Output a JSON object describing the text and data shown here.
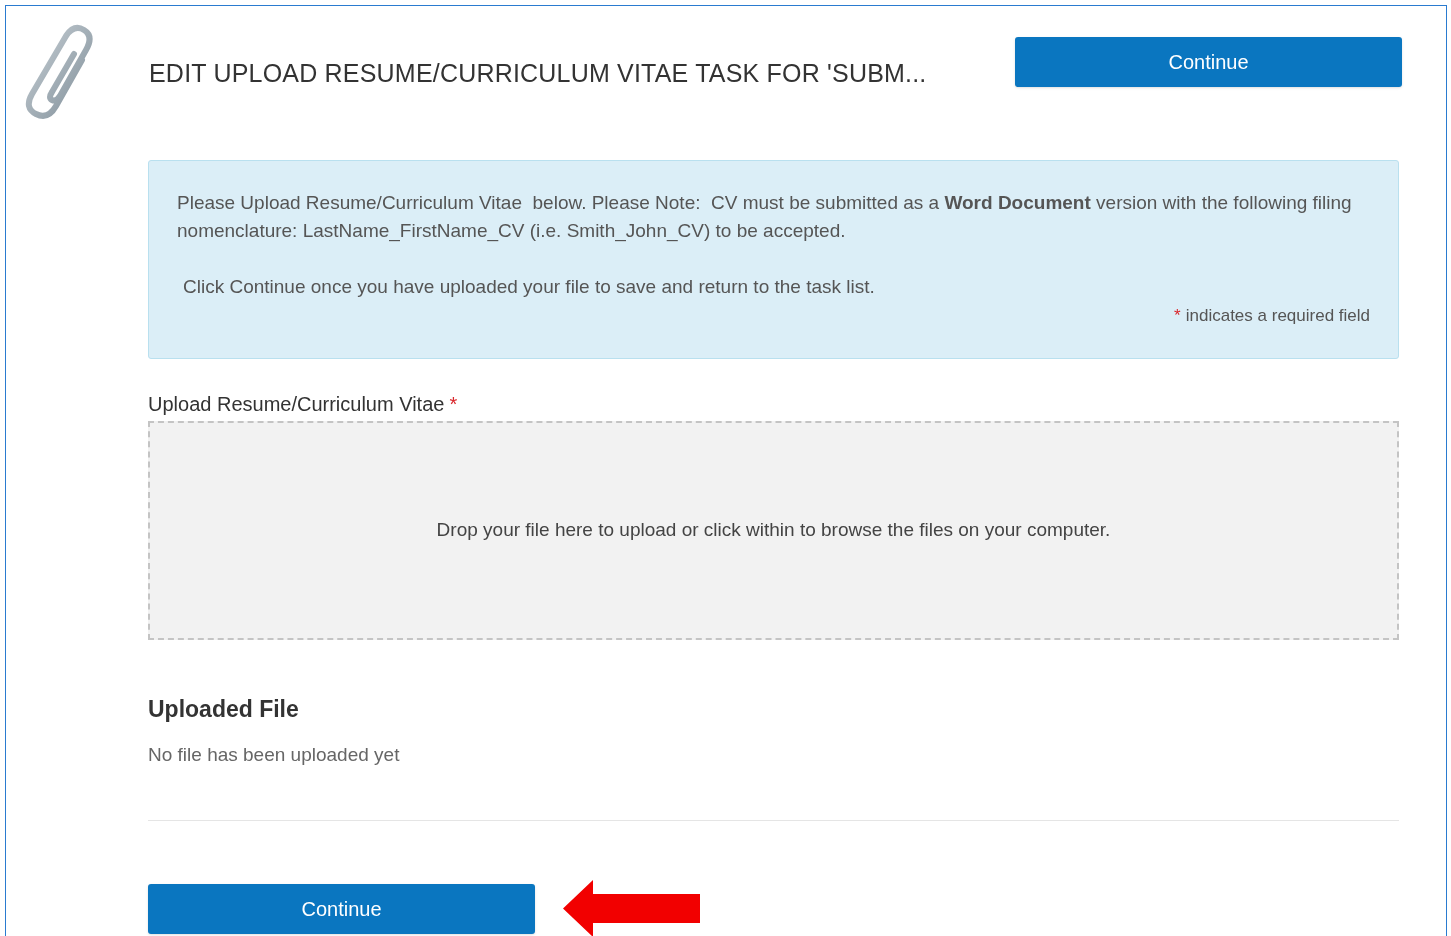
{
  "header": {
    "title": "EDIT UPLOAD RESUME/CURRICULUM VITAE TASK FOR 'SUBM...",
    "button": "Continue"
  },
  "info": {
    "paragraphs": [
      "Please Upload Resume/Curriculum Vitae  below. Please Note:  CV must be submitted as a **Word Document** version with the following filing nomenclature: LastName_FirstName_CV (i.e. Smith_John_CV) to be accepted.",
      "Click Continue once you have uploaded your file to save and return to the task list."
    ],
    "required_mark": "*",
    "required_note": "indicates a required field"
  },
  "upload": {
    "label": "Upload Resume/Curriculum Vitae",
    "required_mark": "*",
    "drop_text": "Drop your file here to upload or click within to browse the files on your computer."
  },
  "uploaded": {
    "heading": "Uploaded File",
    "status": "No file has been uploaded yet"
  },
  "footer": {
    "button": "Continue"
  }
}
